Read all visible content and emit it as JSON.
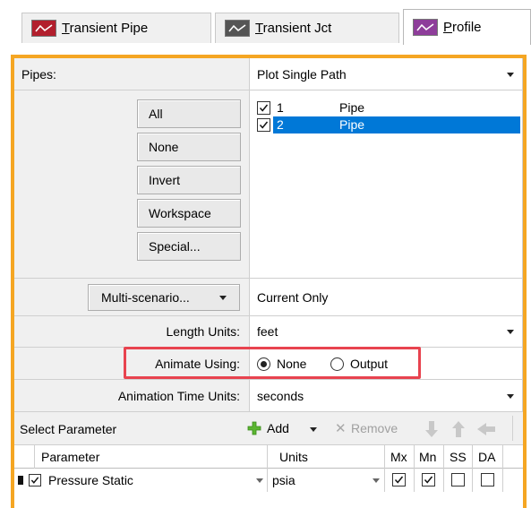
{
  "tabs": [
    {
      "label": "Transient Pipe",
      "mnemonic": "T",
      "rest": "ransient Pipe",
      "icon": "line-graph-red-icon",
      "color": "#b21f2d"
    },
    {
      "label": "Transient Jct",
      "mnemonic": "T",
      "rest": "ransient Jct",
      "icon": "line-graph-gray-icon",
      "color": "#555555"
    },
    {
      "label": "Profile",
      "mnemonic": "P",
      "rest": "rofile",
      "icon": "line-graph-purple-icon",
      "color": "#8e3d9a"
    }
  ],
  "pipes": {
    "label": "Pipes:",
    "path_mode": "Plot Single Path",
    "buttons": [
      "All",
      "None",
      "Invert",
      "Workspace",
      "Special..."
    ],
    "list": [
      {
        "id": "1",
        "type": "Pipe",
        "checked": true,
        "selected": false
      },
      {
        "id": "2",
        "type": "Pipe",
        "checked": true,
        "selected": true
      }
    ]
  },
  "scenario": {
    "button_label": "Multi-scenario...",
    "value": "Current Only"
  },
  "length_units": {
    "label": "Length Units:",
    "value": "feet"
  },
  "animate": {
    "label": "Animate Using:",
    "options": [
      "None",
      "Output"
    ],
    "selected": "None",
    "highlight_color": "#e8434f"
  },
  "animation_time_units": {
    "label": "Animation Time Units:",
    "value": "seconds"
  },
  "select_parameter": {
    "title": "Select Parameter",
    "add_label": "Add",
    "remove_label": "Remove"
  },
  "param_table": {
    "headers": [
      "Parameter",
      "Units",
      "Mx",
      "Mn",
      "SS",
      "DA"
    ],
    "rows": [
      {
        "checked": true,
        "name": "Pressure Static",
        "units": "psia",
        "mx": true,
        "mn": true,
        "ss": false,
        "da": false
      }
    ]
  },
  "colors": {
    "frame": "#f5a623",
    "selection": "#0078d7"
  }
}
